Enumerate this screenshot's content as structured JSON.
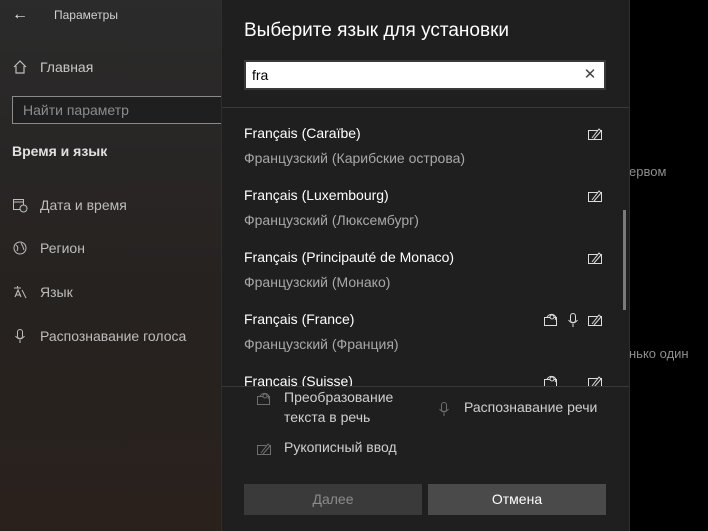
{
  "settings": {
    "title": "Параметры",
    "home": "Главная",
    "search_placeholder": "Найти параметр",
    "section": "Время и язык",
    "nav": [
      {
        "label": "Дата и время"
      },
      {
        "label": "Регион"
      },
      {
        "label": "Язык"
      },
      {
        "label": "Распознавание голоса"
      }
    ],
    "right_texts": [
      "ервом",
      "нько один"
    ]
  },
  "dialog": {
    "title": "Выберите язык для установки",
    "search_value": "fra",
    "languages": [
      {
        "name": "Français (Caraïbe)",
        "sub": "Французский (Карибские острова)",
        "features": [
          "handwriting"
        ]
      },
      {
        "name": "Français (Luxembourg)",
        "sub": "Французский (Люксембург)",
        "features": [
          "handwriting"
        ]
      },
      {
        "name": "Français (Principauté de Monaco)",
        "sub": "Французский (Монако)",
        "features": [
          "handwriting"
        ]
      },
      {
        "name": "Français (France)",
        "sub": "Французский (Франция)",
        "features": [
          "tts",
          "speech",
          "handwriting"
        ]
      },
      {
        "name": "Français (Suisse)",
        "sub": "",
        "features": [
          "tts",
          "handwriting"
        ]
      }
    ],
    "legend": {
      "tts": "Преобразование текста в речь",
      "speech": "Распознавание речи",
      "handwriting": "Рукописный ввод"
    },
    "buttons": {
      "next": "Далее",
      "cancel": "Отмена"
    }
  }
}
